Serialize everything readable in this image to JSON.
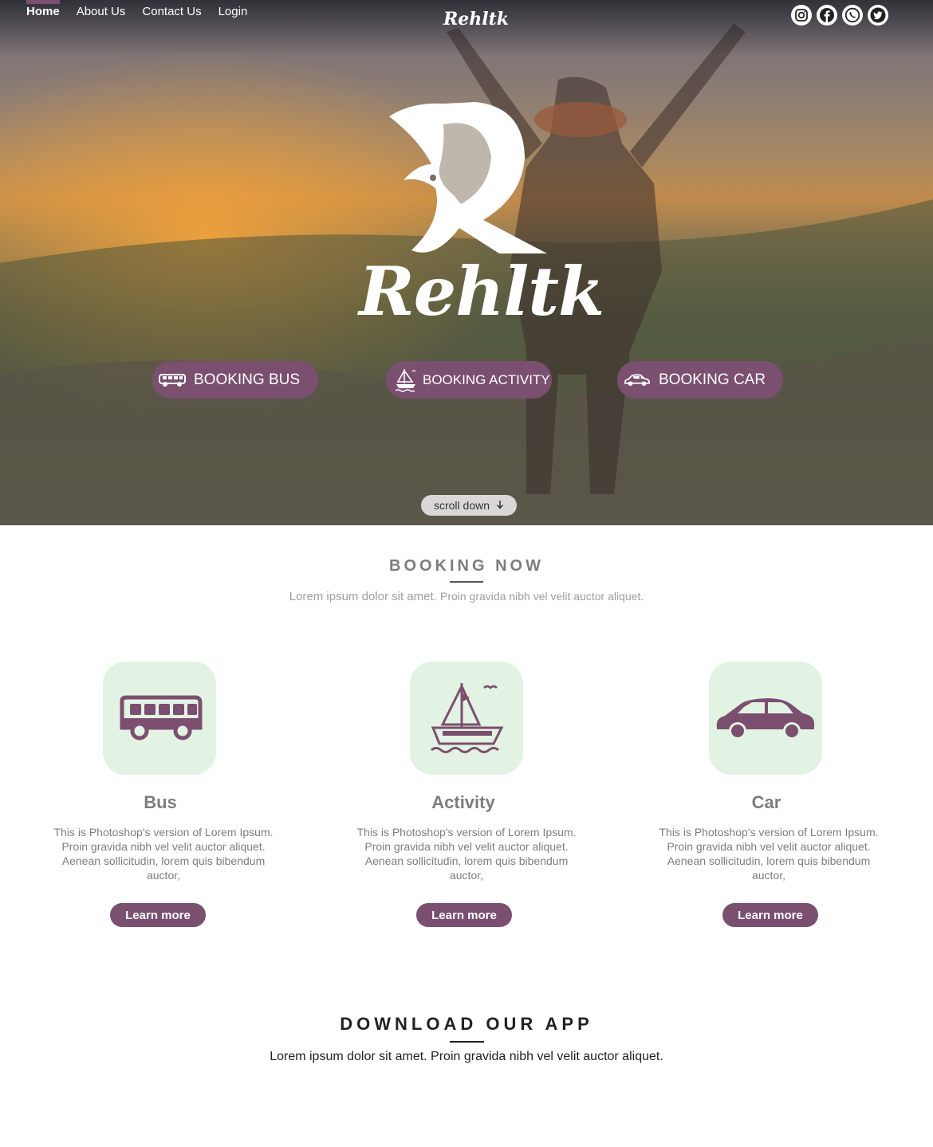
{
  "nav": {
    "items": [
      {
        "label": "Home",
        "active": true
      },
      {
        "label": "About Us"
      },
      {
        "label": "Contact Us"
      },
      {
        "label": "Login"
      }
    ]
  },
  "brand": {
    "name": "Rehltk",
    "logo_text": "Rehltk"
  },
  "socials": [
    "instagram-icon",
    "facebook-icon",
    "whatsapp-icon",
    "twitter-icon"
  ],
  "hero_buttons": [
    {
      "label": "BOOKING BUS",
      "icon": "bus-icon"
    },
    {
      "label": "BOOKING ACTIVITY",
      "icon": "boat-icon"
    },
    {
      "label": "BOOKING CAR",
      "icon": "car-icon"
    }
  ],
  "scroll": {
    "label": "scroll down"
  },
  "booking": {
    "title": "BOOKING NOW",
    "subtitle_a": "Lorem ipsum dolor sit amet.",
    "subtitle_b": "Proin gravida nibh vel velit auctor aliquet."
  },
  "cards": [
    {
      "title": "Bus",
      "text": "This is Photoshop's version  of Lorem Ipsum. Proin gravida nibh vel velit auctor aliquet. Aenean sollicitudin, lorem quis bibendum auctor,",
      "button": "Learn more"
    },
    {
      "title": "Activity",
      "text": "This is Photoshop's version  of Lorem Ipsum. Proin gravida nibh vel velit auctor aliquet. Aenean sollicitudin, lorem quis bibendum auctor,",
      "button": "Learn more"
    },
    {
      "title": "Car",
      "text": "This is Photoshop's version  of Lorem Ipsum. Proin gravida nibh vel velit auctor aliquet. Aenean sollicitudin, lorem quis bibendum auctor,",
      "button": "Learn more"
    }
  ],
  "download": {
    "title": "DOWNLOAD OUR APP",
    "subtitle": "Lorem ipsum dolor sit amet. Proin gravida nibh vel velit auctor aliquet."
  },
  "colors": {
    "accent": "#7b4f6f",
    "card_bg": "#e3f3e3",
    "text_gray": "#7d7d7d"
  }
}
